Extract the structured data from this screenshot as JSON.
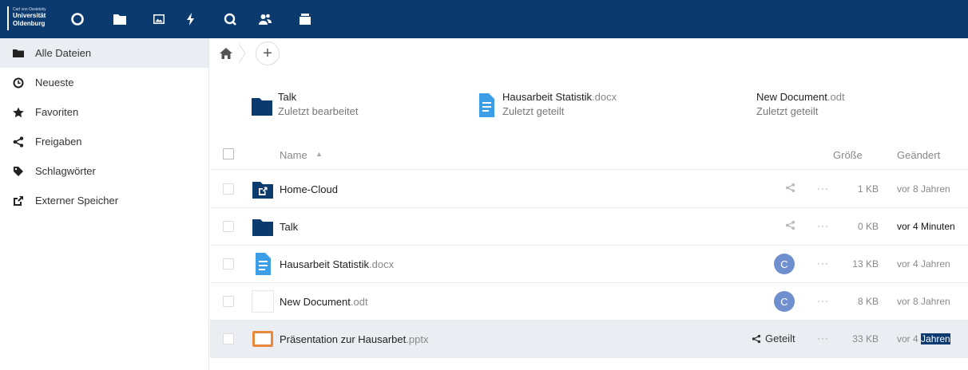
{
  "logo": {
    "line1": "Carl von Ossietzky",
    "line2": "Universität",
    "line3": "Oldenburg"
  },
  "topnav": [
    {
      "icon": "dashboard-circle-icon"
    },
    {
      "icon": "files-folder-icon"
    },
    {
      "icon": "photos-image-icon"
    },
    {
      "icon": "activity-bolt-icon"
    },
    {
      "icon": "search-icon"
    },
    {
      "icon": "contacts-icon"
    },
    {
      "icon": "deck-icon"
    }
  ],
  "sidebar": {
    "items": [
      {
        "label": "Alle Dateien",
        "icon": "folder-icon",
        "active": true
      },
      {
        "label": "Neueste",
        "icon": "clock-icon"
      },
      {
        "label": "Favoriten",
        "icon": "star-icon"
      },
      {
        "label": "Freigaben",
        "icon": "share-icon"
      },
      {
        "label": "Schlagwörter",
        "icon": "tag-icon"
      },
      {
        "label": "Externer Speicher",
        "icon": "external-link-icon"
      }
    ]
  },
  "breadcrumb": {
    "home_icon": "home-icon",
    "add_label": "+"
  },
  "recent": [
    {
      "name": "Talk",
      "ext": "",
      "subtitle": "Zuletzt bearbeitet",
      "icon": "folder-icon"
    },
    {
      "name": "Hausarbeit Statistik",
      "ext": ".docx",
      "subtitle": "Zuletzt geteilt",
      "icon": "document-icon"
    },
    {
      "name": "New Document",
      "ext": ".odt",
      "subtitle": "Zuletzt geteilt",
      "icon": "blank-file-icon"
    }
  ],
  "table": {
    "headers": {
      "name": "Name",
      "sort_indicator": "▲",
      "size": "Größe",
      "modified": "Geändert"
    },
    "rows": [
      {
        "name": "Home-Cloud",
        "ext": "",
        "icon": "external-folder-icon",
        "shared_by": "",
        "more": "···",
        "size": "1 KB",
        "modified": "vor 8 Jahren"
      },
      {
        "name": "Talk",
        "ext": "",
        "icon": "folder-icon",
        "shared_by": "",
        "more": "···",
        "size": "0 KB",
        "modified": "vor 4 Minuten"
      },
      {
        "name": "Hausarbeit Statistik",
        "ext": ".docx",
        "icon": "document-icon",
        "shared_by": "C",
        "more": "···",
        "size": "13 KB",
        "modified": "vor 4 Jahren"
      },
      {
        "name": "New Document",
        "ext": ".odt",
        "icon": "blank-file-icon",
        "shared_by": "C",
        "more": "···",
        "size": "8 KB",
        "modified": "vor 8 Jahren"
      },
      {
        "name": "Präsentation zur Hausarbet",
        "ext": ".pptx",
        "icon": "presentation-icon",
        "shared_label": "Geteilt",
        "more": "···",
        "size": "33 KB",
        "modified_prefix": "vor 4",
        "modified_highlight": "Jahren"
      }
    ]
  },
  "colors": {
    "topbar": "#0b3a6e",
    "folder": "#0b3a6e",
    "doc": "#3d9ee8",
    "presentation": "#e8883d",
    "avatar": "#6f8fcf",
    "selected_row": "#eaeef2"
  }
}
